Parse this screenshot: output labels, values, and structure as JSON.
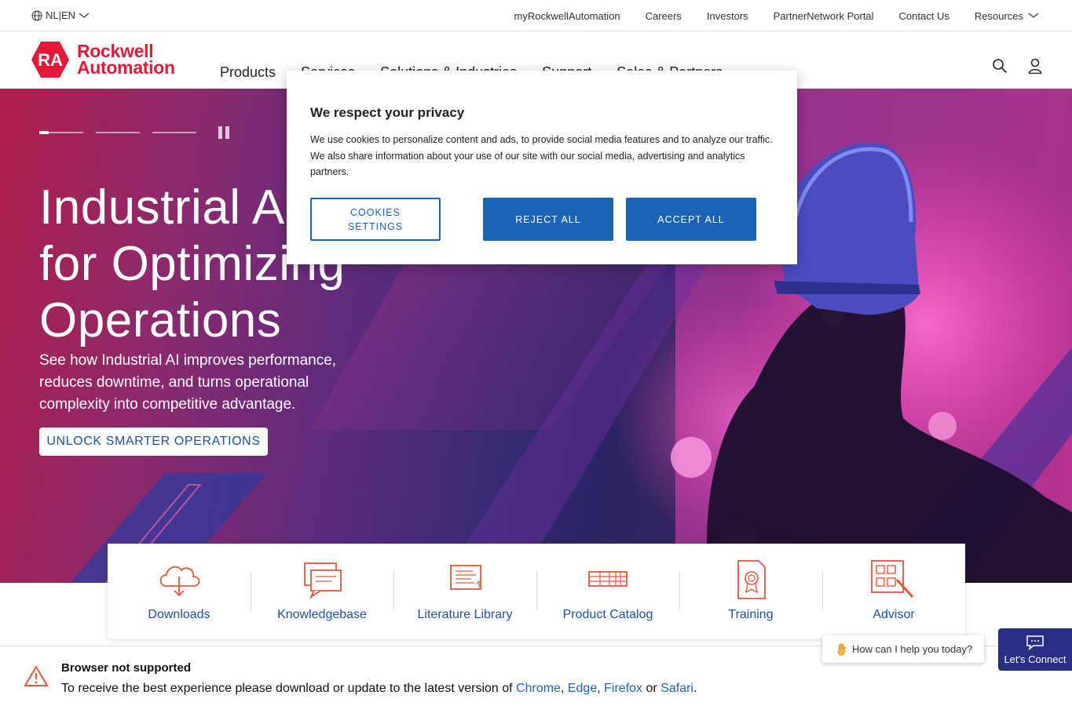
{
  "utility": {
    "language": "NL|EN",
    "links": [
      "myRockwellAutomation",
      "Careers",
      "Investors",
      "PartnerNetwork Portal",
      "Contact Us"
    ],
    "resources": "Resources"
  },
  "brand": {
    "line1": "Rockwell",
    "line2": "Automation",
    "mark": "RA",
    "color": "#e31937"
  },
  "nav": {
    "items": [
      "Products",
      "Services",
      "Solutions & Industries",
      "Support",
      "Sales & Partners"
    ]
  },
  "hero": {
    "title_line1": "Industrial AI",
    "title_line2": "for Optimizing",
    "title_line3": "Operations",
    "subtitle": "See how Industrial AI improves performance, reduces downtime, and turns operational complexity into competitive advantage.",
    "cta": "UNLOCK SMARTER OPERATIONS",
    "slide_count": 3,
    "active_slide": 1
  },
  "quick_links": [
    {
      "label": "Downloads",
      "icon": "cloud-download-icon"
    },
    {
      "label": "Knowledgebase",
      "icon": "chat-bubbles-icon"
    },
    {
      "label": "Literature Library",
      "icon": "document-icon"
    },
    {
      "label": "Product Catalog",
      "icon": "catalog-icon"
    },
    {
      "label": "Training",
      "icon": "certificate-icon"
    },
    {
      "label": "Advisor",
      "icon": "advisor-icon"
    }
  ],
  "cookie": {
    "title": "We respect your privacy",
    "body": "We use cookies to personalize content and ads, to provide social media features and to analyze our traffic. We also share information about your use of our site with our social media, advertising and analytics partners.",
    "settings": "COOKIES SETTINGS",
    "reject": "REJECT ALL",
    "accept": "ACCEPT ALL",
    "button_color": "#1c63b7"
  },
  "banner": {
    "title": "Browser not supported",
    "text_prefix": "To receive the best experience please download or update to the latest version of",
    "browsers": [
      "Chrome",
      "Edge",
      "Firefox",
      "Safari"
    ],
    "sep1": ",",
    "sep2": ",",
    "sep3": "or",
    "end": "."
  },
  "chat": {
    "prompt": "How can I help you today?",
    "button": "Let's Connect"
  }
}
